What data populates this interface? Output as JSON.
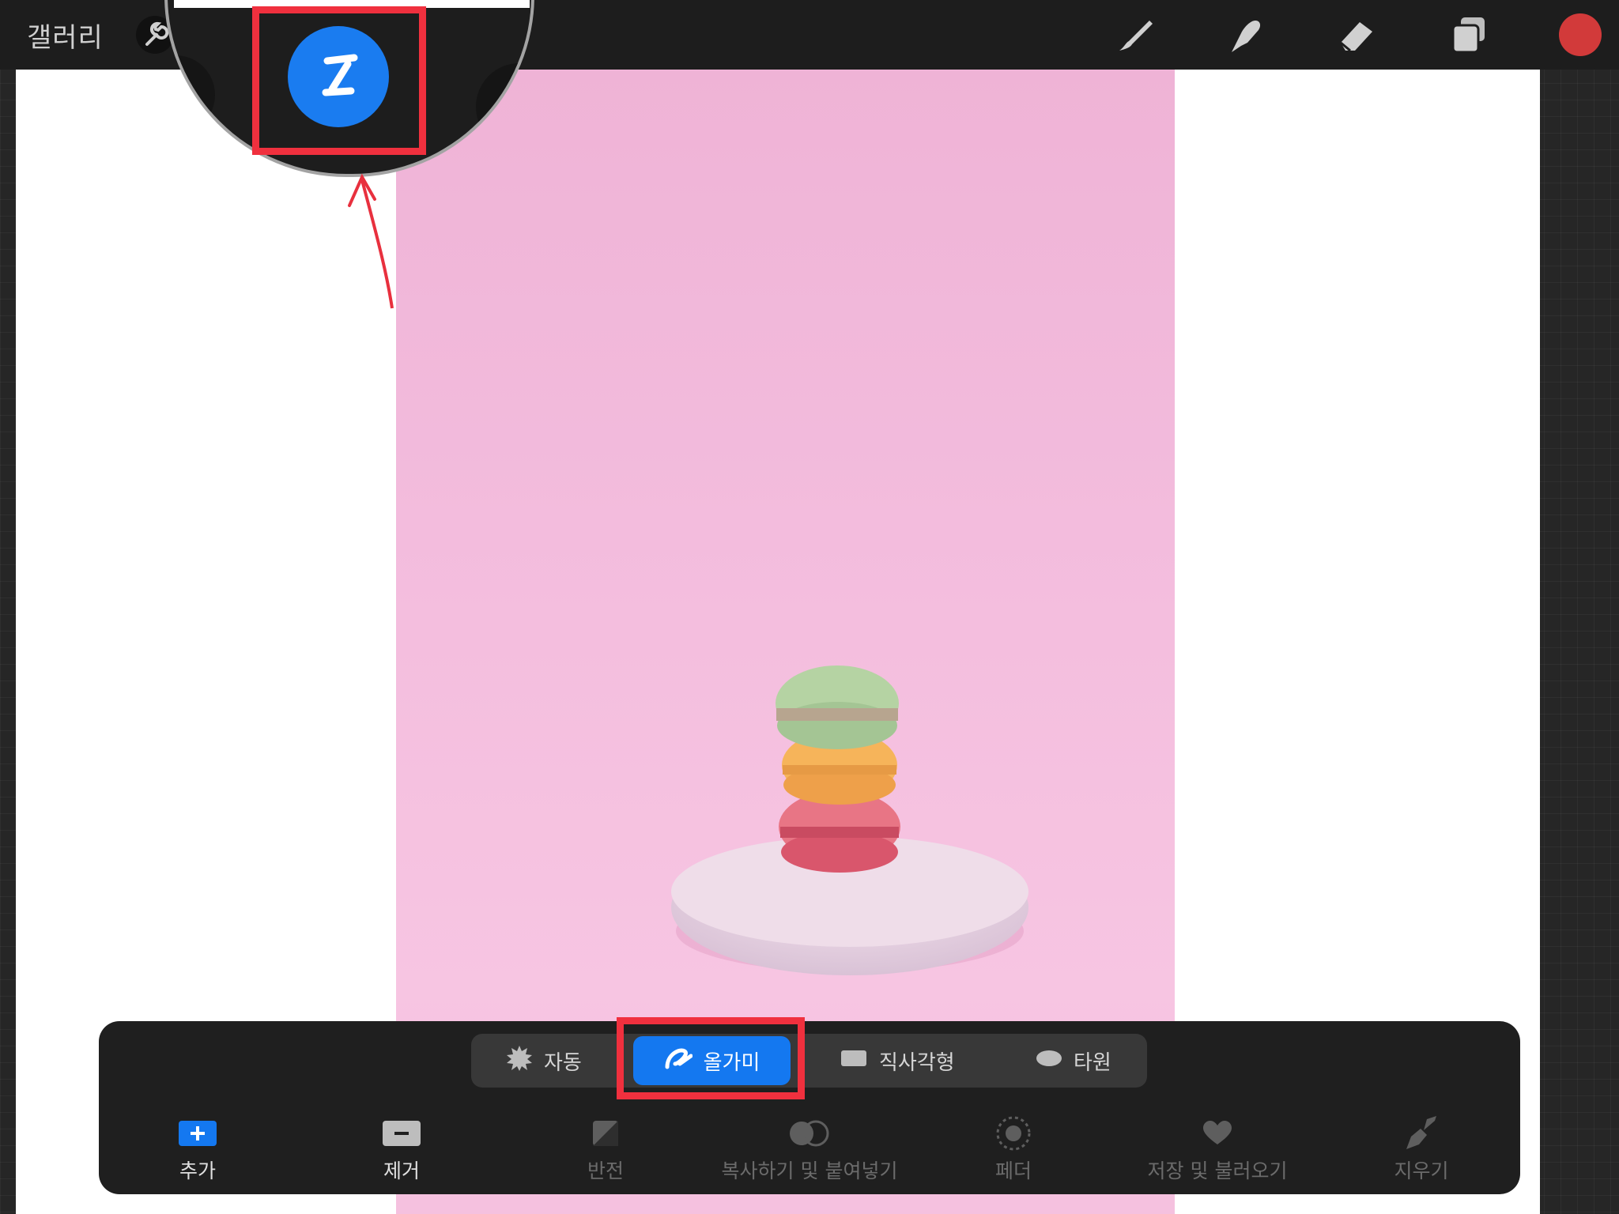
{
  "topbar": {
    "gallery_label": "갤러리",
    "color_swatch": "#d23a3a",
    "tools": [
      "wrench-icon",
      "magic-wand-icon",
      "brush-icon",
      "smudge-icon",
      "eraser-icon",
      "layers-icon"
    ]
  },
  "magnifier": {
    "icon": "selection-icon",
    "accent": "#1a7cf0"
  },
  "selection_modes": [
    {
      "label": "자동",
      "icon": "auto-icon"
    },
    {
      "label": "올가미",
      "icon": "lasso-icon",
      "active": true
    },
    {
      "label": "직사각형",
      "icon": "rectangle-icon"
    },
    {
      "label": "타원",
      "icon": "ellipse-icon"
    }
  ],
  "actions": [
    {
      "label": "추가",
      "icon": "add-icon"
    },
    {
      "label": "제거",
      "icon": "remove-icon"
    },
    {
      "label": "반전",
      "icon": "invert-icon"
    },
    {
      "label": "복사하기 및 붙여넣기",
      "icon": "copy-paste-icon"
    },
    {
      "label": "페더",
      "icon": "feather-icon"
    },
    {
      "label": "저장 및 불러오기",
      "icon": "heart-icon"
    },
    {
      "label": "지우기",
      "icon": "clear-brush-icon"
    }
  ],
  "highlight_color": "#f0303e"
}
